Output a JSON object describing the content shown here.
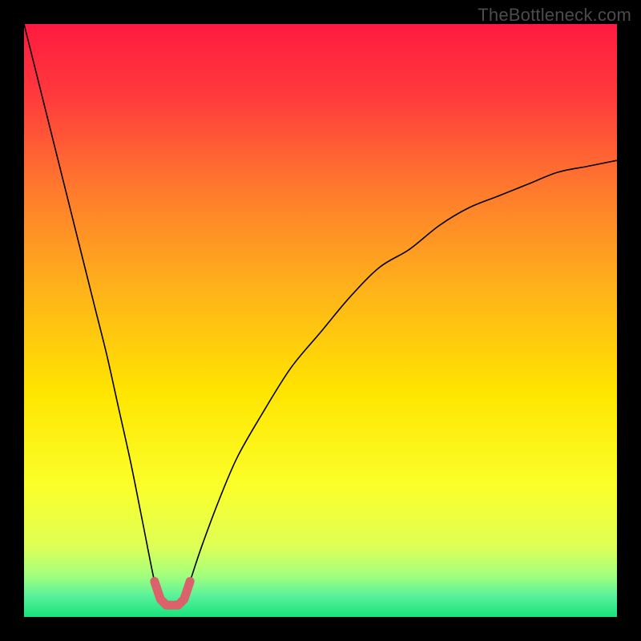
{
  "brand": "TheBottleneck.com",
  "chart_data": {
    "type": "line",
    "title": "",
    "xlabel": "",
    "ylabel": "",
    "xlim": [
      0,
      100
    ],
    "ylim": [
      0,
      100
    ],
    "grid": false,
    "legend": false,
    "background_gradient": {
      "stops": [
        {
          "pos": 0.0,
          "color": "#ff1a3f"
        },
        {
          "pos": 0.12,
          "color": "#ff3a3d"
        },
        {
          "pos": 0.28,
          "color": "#ff7a2d"
        },
        {
          "pos": 0.45,
          "color": "#ffb31a"
        },
        {
          "pos": 0.62,
          "color": "#ffe500"
        },
        {
          "pos": 0.78,
          "color": "#fbff2a"
        },
        {
          "pos": 0.88,
          "color": "#dfff55"
        },
        {
          "pos": 0.93,
          "color": "#a3ff7d"
        },
        {
          "pos": 0.965,
          "color": "#57f29a"
        },
        {
          "pos": 1.0,
          "color": "#18e27a"
        }
      ]
    },
    "series": [
      {
        "name": "bottleneck-curve",
        "stroke": "#000000",
        "stroke_width": 1.6,
        "x": [
          0,
          2,
          4,
          6,
          8,
          10,
          12,
          14,
          16,
          18,
          20,
          22,
          23,
          24,
          25,
          26,
          27,
          28,
          30,
          33,
          36,
          40,
          45,
          50,
          55,
          60,
          65,
          70,
          75,
          80,
          85,
          90,
          95,
          100
        ],
        "y": [
          100,
          92,
          84,
          76,
          68,
          60,
          52,
          44,
          35,
          26,
          16,
          6,
          3,
          2,
          2,
          2,
          3,
          6,
          12,
          20,
          27,
          34,
          42,
          48,
          54,
          59,
          62,
          66,
          69,
          71,
          73,
          75,
          76,
          77
        ]
      },
      {
        "name": "trough-marker",
        "stroke": "#d9626b",
        "stroke_width": 11,
        "linecap": "round",
        "x": [
          22,
          23,
          24,
          25,
          26,
          27,
          28
        ],
        "y": [
          6,
          3,
          2,
          2,
          2,
          3,
          6
        ]
      }
    ]
  }
}
